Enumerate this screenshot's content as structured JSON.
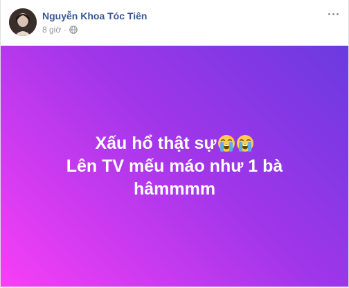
{
  "post": {
    "author_name": "Nguyễn Khoa Tóc Tiên",
    "timestamp": "8 giờ",
    "separator": "·",
    "audience_icon": "globe-icon",
    "menu_icon": "more-options-icon",
    "background": {
      "gradient_colors": [
        "#f73ff6",
        "#a036e9",
        "#6a3ae0"
      ]
    },
    "status_lines": [
      "Xấu hổ thật sự",
      "Lên TV mếu máo như 1 bà",
      "hâmmmm"
    ],
    "emojis": [
      "loudly-crying-face-icon",
      "loudly-crying-face-icon"
    ],
    "colors": {
      "author_link": "#365899",
      "meta_text": "#90949c",
      "status_text": "#ffffff"
    }
  }
}
